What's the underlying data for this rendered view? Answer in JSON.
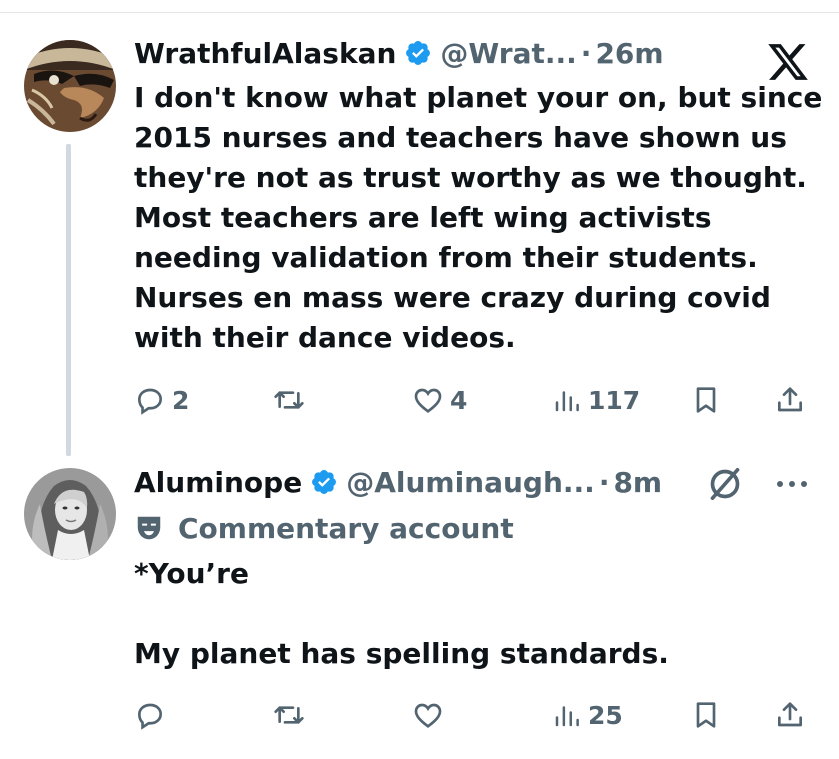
{
  "tweets": [
    {
      "name": "WrathfulAlaskan",
      "handle": "@Wrat...",
      "dot": "·",
      "time": "26m",
      "text": "I don't know what planet your on, but since\n2015 nurses and teachers have shown us\nthey're not as trust worthy as we thought.\nMost teachers are left wing activists\nneeding validation from their students.\nNurses en mass were crazy during covid\nwith their dance videos.",
      "replies": "2",
      "retweets": "",
      "likes": "4",
      "views": "117",
      "avatar_icon": "carved-eagle-mask-avatar"
    },
    {
      "name": "Aluminope",
      "handle": "@Aluminaugh...",
      "dot": "·",
      "time": "8m",
      "label": "Commentary account",
      "label_icon": "theater-mask-icon",
      "text": "*You’re\n\nMy planet has spelling standards.",
      "replies": "",
      "retweets": "",
      "likes": "",
      "views": "25",
      "avatar_icon": "woman-portrait-avatar"
    }
  ],
  "colors": {
    "verified_blue": "#1d9bf0",
    "secondary_text": "#536471",
    "primary_text": "#0f1419",
    "thread_line": "#cfd9de"
  },
  "icons": {
    "top_right": "x-logo-icon",
    "second_top_right": "grok-slash-icon",
    "more": "more-dots-icon"
  }
}
